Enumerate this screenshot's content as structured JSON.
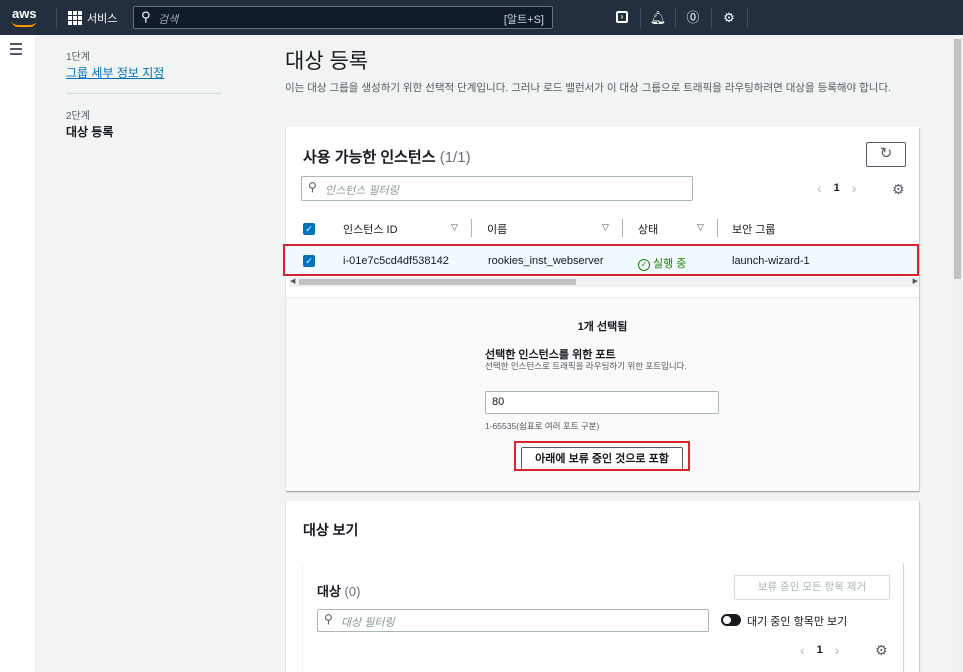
{
  "topnav": {
    "logo_text": "aws",
    "services_label": "서비스",
    "search_placeholder": "검색",
    "search_shortcut": "[알트+S]",
    "icons": [
      "terminal-icon",
      "bell-icon",
      "help-icon",
      "gear-icon"
    ]
  },
  "steps": {
    "step1_label": "1단계",
    "step1_link": "그룹 세부 정보 지정",
    "step2_label": "2단계",
    "step2_current": "대상 등록"
  },
  "page": {
    "title": "대상 등록",
    "description": "이는 대상 그룹을 생성하기 위한 선택적 단계입니다. 그러나 로드 밸런서가 이 대상 그룹으로 트래픽을 라우팅하려면 대상을 등록해야 합니다."
  },
  "instances": {
    "title": "사용 가능한 인스턴스",
    "count": "(1/1)",
    "filter_placeholder": "인스턴스 필터링",
    "page_number": "1",
    "columns": [
      "인스턴스 ID",
      "이름",
      "상태",
      "보안 그룹"
    ],
    "rows": [
      {
        "instance_id": "i-01e7c5cd4df538142",
        "name": "rookies_inst_webserver",
        "status": "실행 중",
        "security_group": "launch-wizard-1"
      }
    ],
    "selected_count": "1개 선택됨",
    "port_label": "선택한 인스턴스를 위한 포트",
    "port_description": "선택한 인스턴스로 트래픽을 라우팅하기 위한 포트입니다.",
    "port_value": "80",
    "port_hint": "1-65535(쉼표로 여러 포트 구분)",
    "include_button": "아래에 보류 중인 것으로 포함"
  },
  "review": {
    "title": "대상 보기",
    "targets_title": "대상",
    "targets_count": "(0)",
    "remove_all_button": "보류 중인 모든 항목 제거",
    "filter_placeholder": "대상 필터링",
    "toggle_label": "대기 중인 항목만 보기",
    "page_number": "1"
  },
  "colors": {
    "nav_bg": "#232f3e",
    "link": "#0073bb",
    "success": "#1d8102",
    "highlight_border": "#d9232e"
  }
}
